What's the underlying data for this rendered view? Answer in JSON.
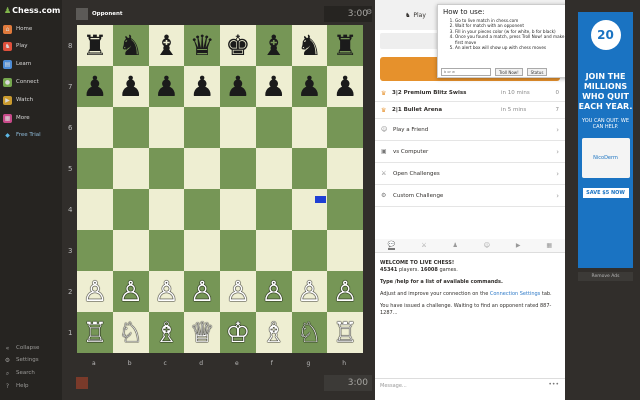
{
  "nav": {
    "logo": "Chess.com",
    "items": [
      {
        "label": "Home",
        "icon": "home-icon",
        "color": "#e07a3c"
      },
      {
        "label": "Play",
        "icon": "play-icon",
        "color": "#e0503c"
      },
      {
        "label": "Learn",
        "icon": "learn-icon",
        "color": "#4d8cd6"
      },
      {
        "label": "Connect",
        "icon": "connect-icon",
        "color": "#76a84e"
      },
      {
        "label": "Watch",
        "icon": "watch-icon",
        "color": "#c99a2e"
      },
      {
        "label": "More",
        "icon": "more-icon",
        "color": "#c94a8a"
      },
      {
        "label": "Free Trial",
        "icon": "diamond-icon",
        "color": "#5db8e6"
      }
    ],
    "bottom_items": [
      {
        "label": "Collapse"
      },
      {
        "label": "Settings"
      },
      {
        "label": "Search"
      },
      {
        "label": "Help"
      }
    ]
  },
  "opponent": {
    "name": "Opponent",
    "clock": "3:00"
  },
  "player": {
    "name": "",
    "clock": "3:00"
  },
  "board": {
    "ranks": [
      "8",
      "7",
      "6",
      "5",
      "4",
      "3",
      "2",
      "1"
    ],
    "files": [
      "a",
      "b",
      "c",
      "d",
      "e",
      "f",
      "g",
      "h"
    ],
    "rows": [
      [
        "♜",
        "♞",
        "♝",
        "♛",
        "♚",
        "♝",
        "♞",
        "♜"
      ],
      [
        "♟",
        "♟",
        "♟",
        "♟",
        "♟",
        "♟",
        "♟",
        "♟"
      ],
      [
        "",
        "",
        "",
        "",
        "",
        "",
        "",
        ""
      ],
      [
        "",
        "",
        "",
        "",
        "",
        "",
        "",
        ""
      ],
      [
        "",
        "",
        "",
        "",
        "",
        "",
        "",
        ""
      ],
      [
        "",
        "",
        "",
        "",
        "",
        "",
        "",
        ""
      ],
      [
        "♙",
        "♙",
        "♙",
        "♙",
        "♙",
        "♙",
        "♙",
        "♙"
      ],
      [
        "♖",
        "♘",
        "♗",
        "♕",
        "♔",
        "♗",
        "♘",
        "♖"
      ]
    ],
    "light_color": "#eeeed2",
    "dark_color": "#769656"
  },
  "panel": {
    "tab": "Play",
    "time_control": "3 | 2",
    "lobby": [
      {
        "name": "3|2 Premium Blitz Swiss",
        "time": "in 10 mins",
        "count": "0"
      },
      {
        "name": "2|1 Bullet Arena",
        "time": "in 5 mins",
        "count": "7"
      }
    ],
    "menu": [
      {
        "label": "Play a Friend"
      },
      {
        "label": "vs Computer"
      },
      {
        "label": "Open Challenges"
      },
      {
        "label": "Custom Challenge"
      }
    ],
    "chat": {
      "welcome": "WELCOME TO LIVE CHESS!",
      "players_count": "45341",
      "players_suffix": " players. ",
      "games_count": "16008",
      "games_suffix": " games.",
      "help_text": "Type /help for a list of available commands.",
      "adjust_prefix": "Adjust and improve your connection on the ",
      "adjust_link": "Connection Settings",
      "adjust_suffix": " tab.",
      "challenge_text": "You have issued a challenge. Waiting to find an opponent rated 887-1287..."
    },
    "message_placeholder": "Message..."
  },
  "popup": {
    "title": "How to use:",
    "steps": [
      "Go to live match in chess.com",
      "Wait for match with an opponent",
      "Fill in your pieces color (w for white, b for black)",
      "Once you found a match, press Troll Now! and make any first move",
      "An alert box will show up with chess moves"
    ],
    "input_value": "b or w",
    "troll_button": "Troll Now!",
    "status_button": "Status"
  },
  "ad": {
    "badge": "20",
    "headline": "JOIN THE MILLIONS WHO QUIT EACH YEAR.",
    "sub": "YOU CAN QUIT. WE CAN HELP.",
    "product": "NicoDerm",
    "save": "SAVE $5 NOW",
    "remove": "Remove Ads"
  }
}
